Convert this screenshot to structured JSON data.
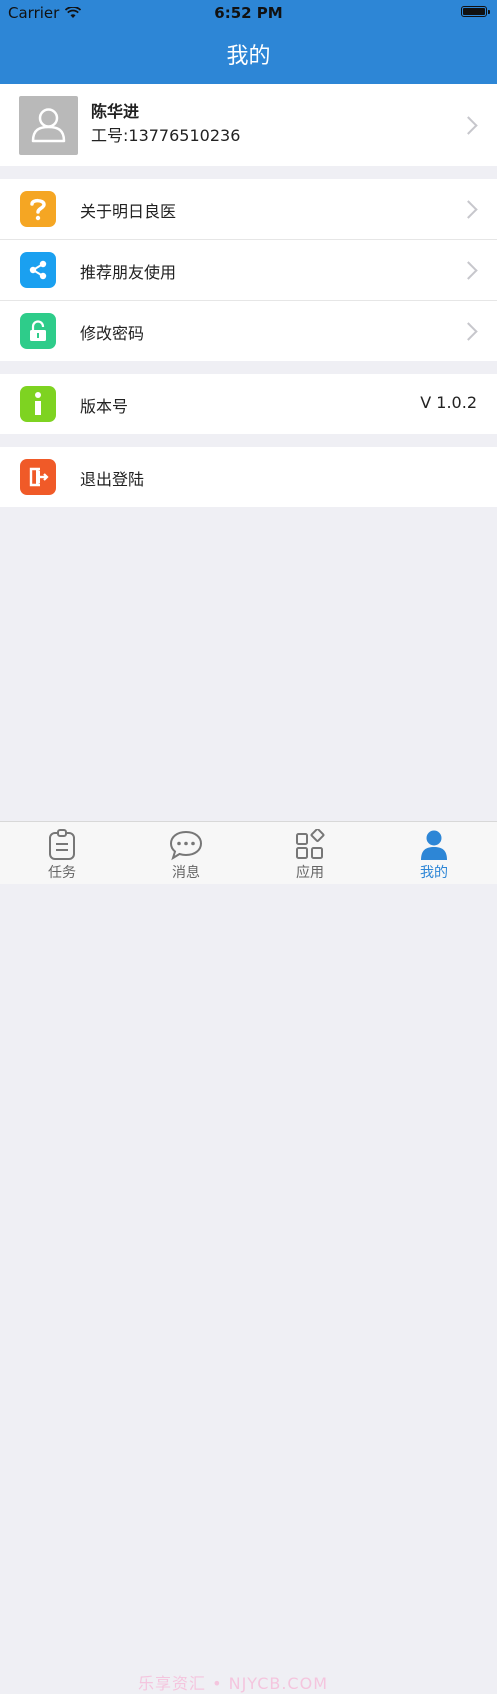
{
  "status_bar": {
    "carrier": "Carrier",
    "time": "6:52 PM"
  },
  "header": {
    "title": "我的"
  },
  "profile": {
    "name": "陈华进",
    "id_text": "工号:13776510236"
  },
  "menu": {
    "about": {
      "label": "关于明日良医",
      "icon": "question-icon",
      "color": "#f5a623"
    },
    "share": {
      "label": "推荐朋友使用",
      "icon": "share-icon",
      "color": "#1aa0f0"
    },
    "password": {
      "label": "修改密码",
      "icon": "unlock-icon",
      "color": "#2ecc8a"
    },
    "version": {
      "label": "版本号",
      "value": "V 1.0.2",
      "icon": "info-icon",
      "color": "#7ed321"
    },
    "logout": {
      "label": "退出登陆",
      "icon": "exit-icon",
      "color": "#f05a28"
    }
  },
  "tabbar": {
    "tasks": "任务",
    "messages": "消息",
    "apps": "应用",
    "mine": "我的",
    "active_color": "#2d86d6"
  },
  "watermark": "乐享资汇 • NJYCB.COM"
}
